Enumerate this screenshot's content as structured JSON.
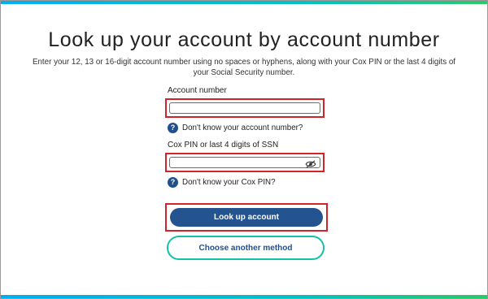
{
  "page": {
    "title": "Look up your account by account number",
    "subtitle_line1": "Enter your 12, 13 or 16-digit account number using no spaces or hyphens, along with your Cox PIN or the last 4 digits of",
    "subtitle_line2": "your Social Security number."
  },
  "form": {
    "account_label": "Account number",
    "account_value": "",
    "account_help": "Don't know your account number?",
    "pin_label": "Cox PIN or last 4 digits of SSN",
    "pin_value": "",
    "pin_help": "Don't know your Cox PIN?",
    "help_glyph": "?",
    "eye_icon": "eye-slash-icon"
  },
  "actions": {
    "primary_label": "Look up account",
    "secondary_label": "Choose another method"
  },
  "colors": {
    "accent_red": "#d0232a",
    "primary_blue": "#24548f",
    "secondary_border": "#12c2a6",
    "bar_start": "#00aeef",
    "bar_end": "#2cc86a"
  }
}
